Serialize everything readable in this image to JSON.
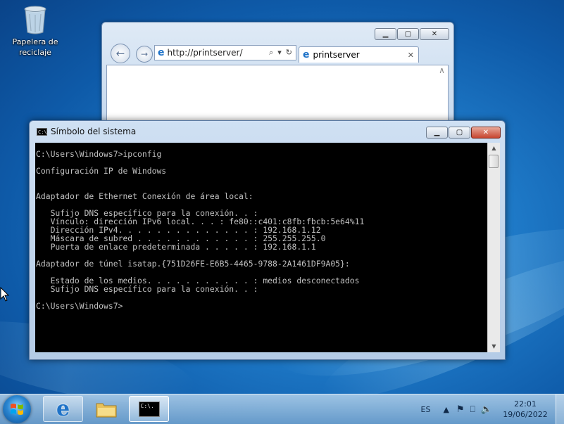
{
  "desktop": {
    "recycle_bin_label_line1": "Papelera de",
    "recycle_bin_label_line2": "reciclaje"
  },
  "browser": {
    "address": "http://printserver/",
    "tab_title": "printserver"
  },
  "cmd": {
    "title": "Símbolo del sistema",
    "icon_text": "C:\\.",
    "output": "C:\\Users\\Windows7>ipconfig\n\nConfiguración IP de Windows\n\n\nAdaptador de Ethernet Conexión de área local:\n\n   Sufijo DNS específico para la conexión. . :\n   Vínculo: dirección IPv6 local. . . : fe80::c401:c8fb:fbcb:5e64%11\n   Dirección IPv4. . . . . . . . . . . . . . : 192.168.1.12\n   Máscara de subred . . . . . . . . . . . . : 255.255.255.0\n   Puerta de enlace predeterminada . . . . . : 192.168.1.1\n\nAdaptador de túnel isatap.{751D26FE-E6B5-4465-9788-2A1461DF9A05}:\n\n   Estado de los medios. . . . . . . . . . . : medios desconectados\n   Sufijo DNS específico para la conexión. . :\n\nC:\\Users\\Windows7>"
  },
  "taskbar": {
    "language": "ES",
    "time": "22:01",
    "date": "19/06/2022",
    "cmd_icon_text": "C:\\."
  },
  "colors": {
    "console_text": "#c0c0c0",
    "console_bg": "#000000",
    "desktop_accent": "#1f7bc9"
  }
}
